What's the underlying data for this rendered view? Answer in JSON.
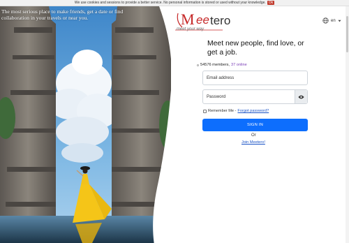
{
  "cookie_banner": {
    "text": "We use cookies and sessions to provide a better service. No personal information is stored or used without your knowledge.",
    "ok_label": "Ok"
  },
  "hero": {
    "tagline": "The most serious place to make friends, get a date or find collaboration in your travels or near you."
  },
  "brand": {
    "logo_text_prefix": "M",
    "logo_text_suffix": "tero",
    "logo_highlight": "ee",
    "slogan": "meet your way",
    "colors": {
      "primary": "#0d6efd",
      "brand_red": "#c62828",
      "link": "#1a53c6",
      "online": "#7b3fb7"
    }
  },
  "language": {
    "current": "en",
    "icon": "globe-icon",
    "chevron": "chevron-down-icon"
  },
  "main": {
    "headline": "Meet new people, find love, or get a job.",
    "members_count": "54576 members,",
    "online_count": "37 online"
  },
  "form": {
    "email_placeholder": "Email address",
    "password_placeholder": "Password",
    "remember_label": "Remember Me -",
    "forgot_label": "Forgot password?",
    "signin_label": "SIGN IN",
    "or_label": "Or",
    "join_label": "Join Meetero!"
  }
}
